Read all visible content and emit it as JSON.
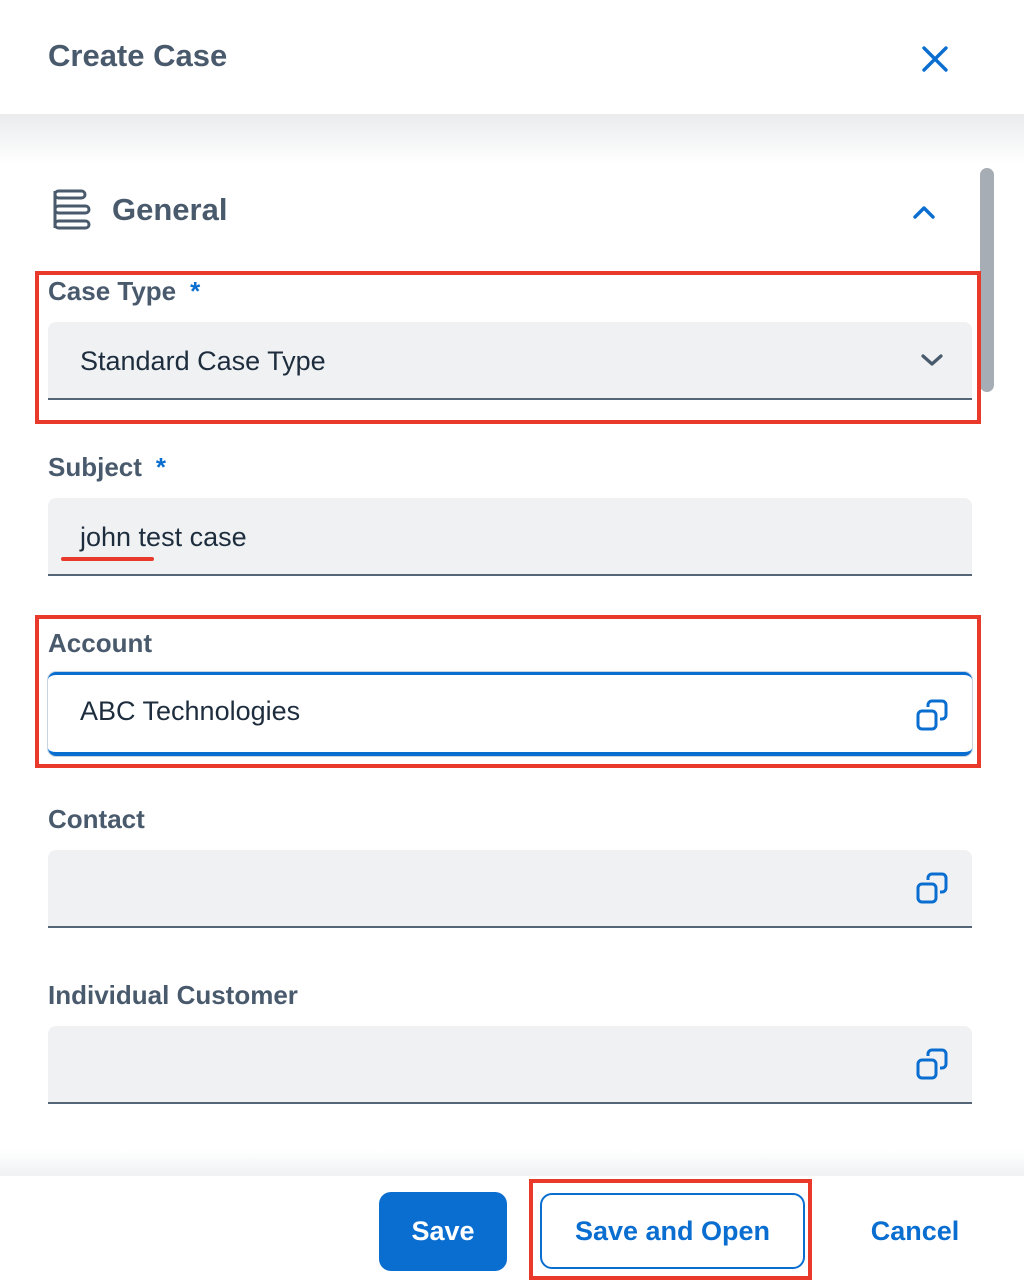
{
  "dialog": {
    "title": "Create Case"
  },
  "section": {
    "title": "General"
  },
  "fields": {
    "case_type": {
      "label": "Case Type",
      "required_mark": "*",
      "value": "Standard Case Type"
    },
    "subject": {
      "label": "Subject",
      "required_mark": "*",
      "value": "john test case"
    },
    "account": {
      "label": "Account",
      "value": "ABC Technologies"
    },
    "contact": {
      "label": "Contact",
      "value": ""
    },
    "individual_customer": {
      "label": "Individual Customer",
      "value": ""
    }
  },
  "footer": {
    "save_label": "Save",
    "save_and_open_label": "Save and Open",
    "cancel_label": "Cancel"
  },
  "icons": {
    "close": "close-icon",
    "section": "section-list-icon",
    "collapse": "chevron-up-icon",
    "dropdown": "chevron-down-icon",
    "value_help": "value-help-icon"
  },
  "colors": {
    "accent": "#0a6ed1",
    "text_heading": "#4a5a6d",
    "field_background": "#eff1f2",
    "annotation": "#e8392b"
  }
}
